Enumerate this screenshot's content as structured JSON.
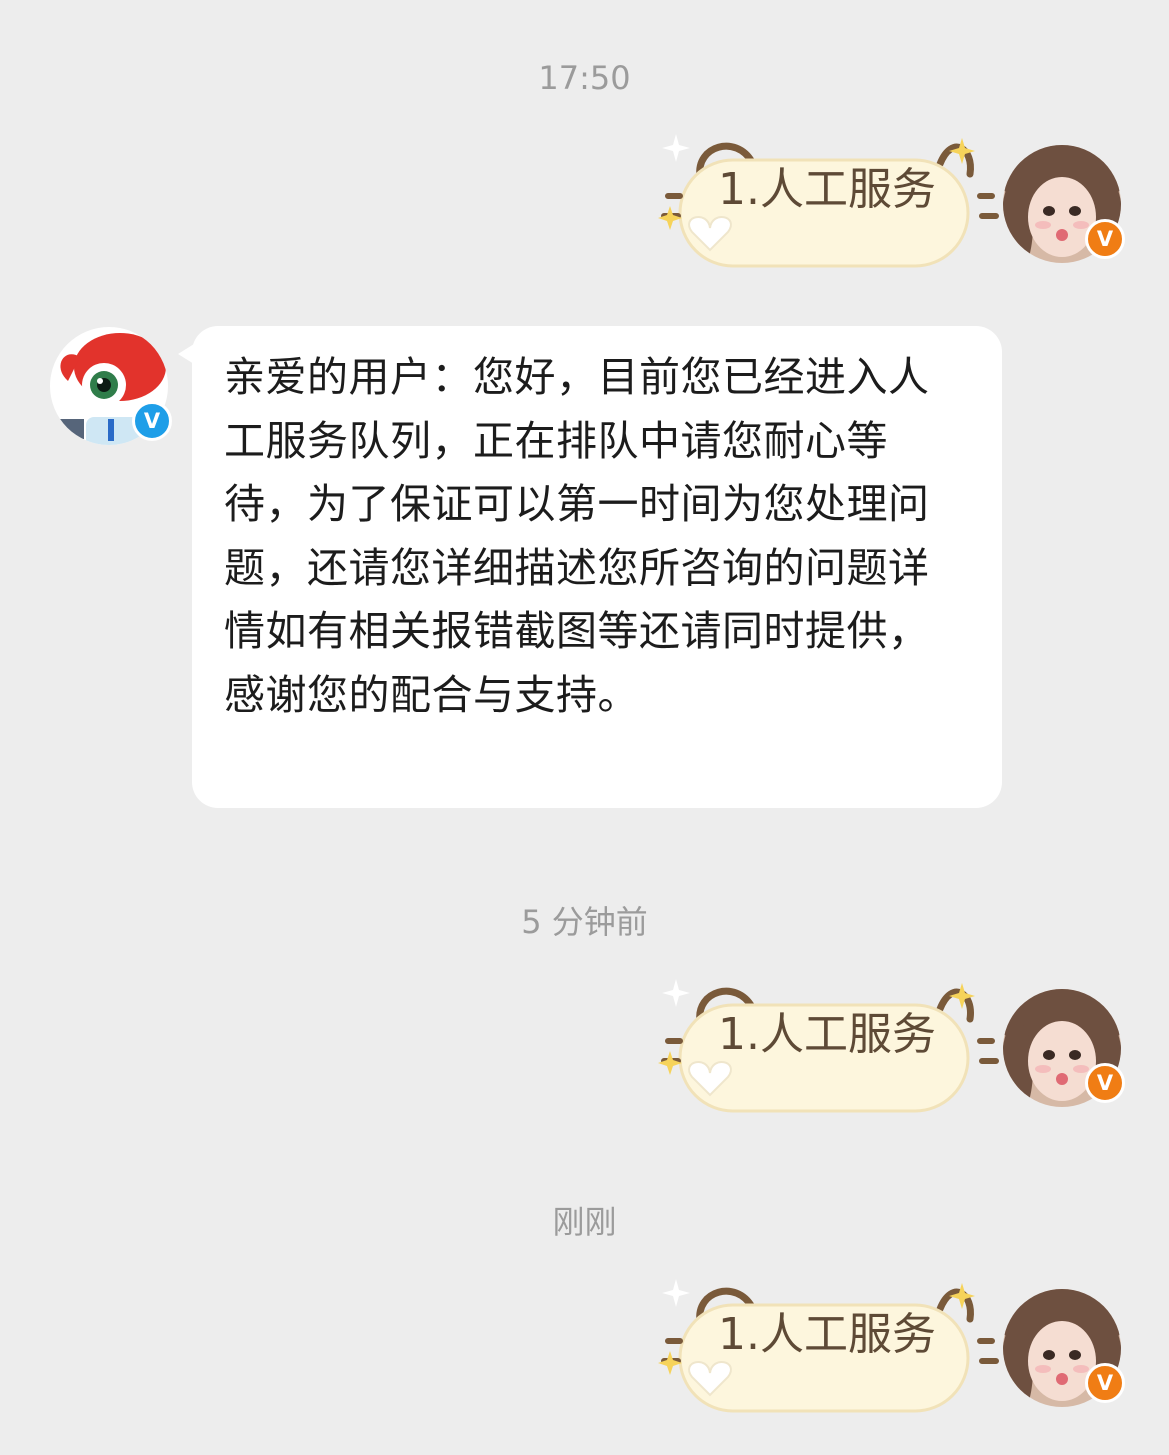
{
  "timestamps": {
    "first": "17:50",
    "second": "5 分钟前",
    "third": "刚刚"
  },
  "messages": [
    {
      "sender": "user",
      "text": "1.人工服务"
    },
    {
      "sender": "bot",
      "text": "亲爱的用户：您好，目前您已经进入人工服务队列，正在排队中请您耐心等待，为了保证可以第一时间为您处理问题，还请您详细描述您所咨询的问题详情如有相关报错截图等还请同时提供，感谢您的配合与支持。"
    },
    {
      "sender": "user",
      "text": "1.人工服务"
    },
    {
      "sender": "user",
      "text": "1.人工服务"
    }
  ],
  "badges": {
    "user_badge": "V",
    "bot_badge": "V"
  },
  "colors": {
    "background": "#ededed",
    "user_bubble_fill": "#fdf6dd",
    "user_bubble_outline": "#7a5a3a",
    "user_badge": "#f07d14",
    "bot_badge": "#1e9ee8",
    "bot_bubble": "#ffffff"
  },
  "icons": {
    "user_avatar": "user-avatar-icon",
    "bot_avatar": "weibo-mascot-icon",
    "sparkle": "sparkle-icon",
    "heart": "heart-icon"
  }
}
